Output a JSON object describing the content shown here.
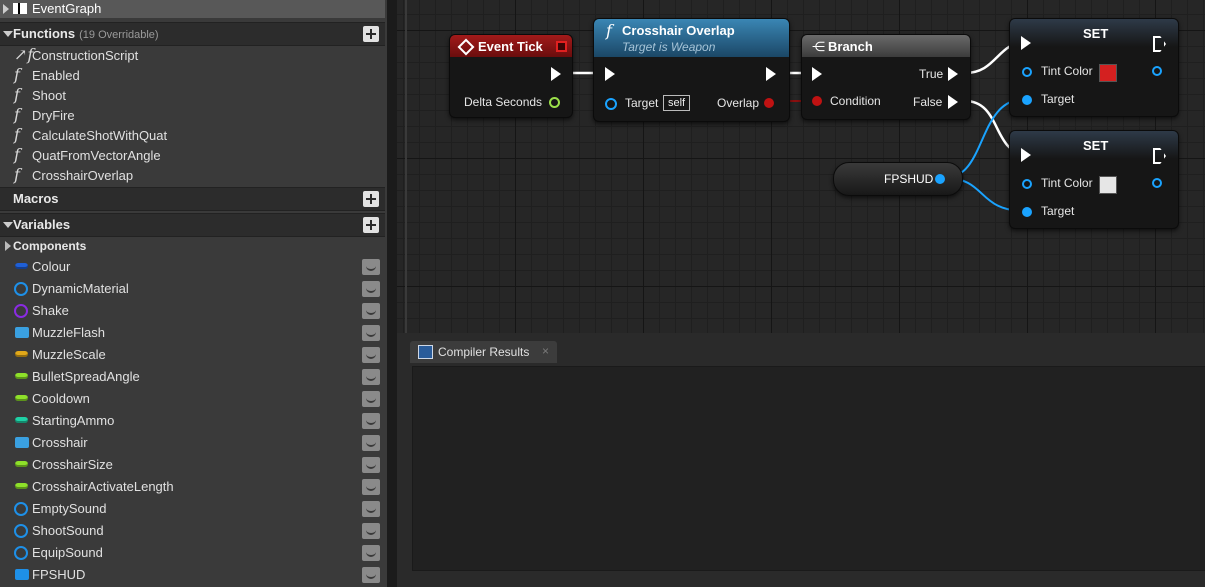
{
  "sidebar": {
    "event_graph": "EventGraph",
    "functions_header": "Functions",
    "functions_note": "(19 Overridable)",
    "functions": [
      "ConstructionScript",
      "Enabled",
      "Shoot",
      "DryFire",
      "CalculateShotWithQuat",
      "QuatFromVectorAngle",
      "CrosshairOverlap"
    ],
    "macros_header": "Macros",
    "variables_header": "Variables",
    "components_header": "Components",
    "variables": [
      {
        "name": "Colour",
        "icon": "vector-pill-icon",
        "color": "#1f5fd6"
      },
      {
        "name": "DynamicMaterial",
        "icon": "object-ring-icon",
        "color": "#1e90e8"
      },
      {
        "name": "Shake",
        "icon": "class-ring-icon",
        "color": "#8a2be2"
      },
      {
        "name": "MuzzleFlash",
        "icon": "particle-icon",
        "color": "#3aa0e0"
      },
      {
        "name": "MuzzleScale",
        "icon": "float-pill-icon",
        "color": "#e0a81a"
      },
      {
        "name": "BulletSpreadAngle",
        "icon": "float-pill-icon",
        "color": "#8ee02a"
      },
      {
        "name": "Cooldown",
        "icon": "float-pill-icon",
        "color": "#8ee02a"
      },
      {
        "name": "StartingAmmo",
        "icon": "int-pill-icon",
        "color": "#1fd1a6"
      },
      {
        "name": "Crosshair",
        "icon": "texture-icon",
        "color": "#3aa0e0"
      },
      {
        "name": "CrosshairSize",
        "icon": "float-pill-icon",
        "color": "#8ee02a"
      },
      {
        "name": "CrosshairActivateLength",
        "icon": "float-pill-icon",
        "color": "#8ee02a"
      },
      {
        "name": "EmptySound",
        "icon": "object-ring-icon",
        "color": "#1e90e8"
      },
      {
        "name": "ShootSound",
        "icon": "object-ring-icon",
        "color": "#1e90e8"
      },
      {
        "name": "EquipSound",
        "icon": "object-ring-icon",
        "color": "#1e90e8"
      },
      {
        "name": "FPSHUD",
        "icon": "hud-icon",
        "color": "#1e90e8"
      }
    ]
  },
  "graph": {
    "event_tick": {
      "title": "Event Tick",
      "pin": "Delta Seconds"
    },
    "overlap": {
      "title": "Crosshair Overlap",
      "subtitle": "Target is Weapon",
      "target": "Target",
      "self": "self",
      "out": "Overlap"
    },
    "branch": {
      "title": "Branch",
      "condition": "Condition",
      "true": "True",
      "false": "False"
    },
    "set1": {
      "title": "SET",
      "pin": "Tint Color",
      "target": "Target",
      "swatch": "#d42020"
    },
    "set2": {
      "title": "SET",
      "pin": "Tint Color",
      "target": "Target",
      "swatch": "#e6e6e6"
    },
    "fpshud": {
      "title": "FPSHUD"
    }
  },
  "bottom": {
    "tab_label": "Compiler Results",
    "tab_close": "×"
  },
  "colors": {
    "event_header": "#8a1414",
    "function_header": "#2f6a8f",
    "object_pin": "#1aa3ff",
    "bool_pin": "#a31010",
    "float_pin": "#9be04a"
  }
}
